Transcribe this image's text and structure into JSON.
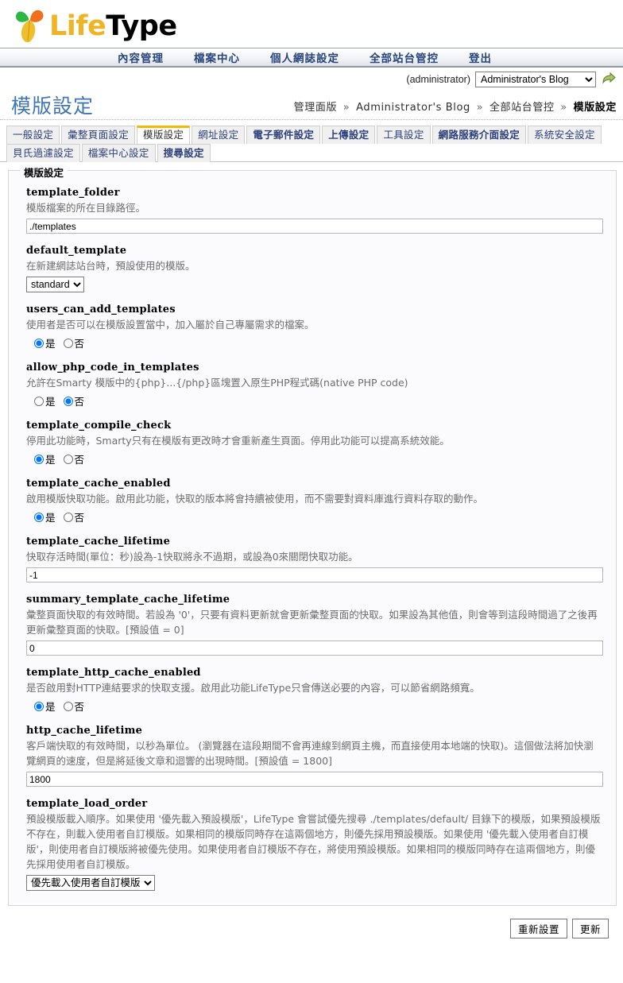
{
  "brand": {
    "life": "Life",
    "type": "Type",
    "logo_icon": "leaf-logo-icon"
  },
  "main_nav": {
    "items": [
      {
        "label": "內容管理"
      },
      {
        "label": "檔案中心"
      },
      {
        "label": "個人網誌設定"
      },
      {
        "label": "全部站台管控"
      },
      {
        "label": "登出"
      }
    ]
  },
  "blog_bar": {
    "admin_name": "(administrator)",
    "selected_blog": "Administrator's Blog",
    "blog_options": [
      "Administrator's Blog"
    ],
    "go_icon": "go-arrow-icon"
  },
  "page": {
    "title": "模版設定"
  },
  "breadcrumb": {
    "items": [
      "管理面版",
      "Administrator's Blog",
      "全部站台管控"
    ],
    "current": "模版設定",
    "separator": "»"
  },
  "tabs": [
    {
      "label": "一般設定",
      "active": false,
      "bold": false
    },
    {
      "label": "彙整頁面設定",
      "active": false,
      "bold": false
    },
    {
      "label": "模版設定",
      "active": true,
      "bold": false
    },
    {
      "label": "網址設定",
      "active": false,
      "bold": false
    },
    {
      "label": "電子郵件設定",
      "active": false,
      "bold": true
    },
    {
      "label": "上傳設定",
      "active": false,
      "bold": true
    },
    {
      "label": "工具設定",
      "active": false,
      "bold": false
    },
    {
      "label": "網路服務介面設定",
      "active": false,
      "bold": true
    },
    {
      "label": "系統安全設定",
      "active": false,
      "bold": false
    },
    {
      "label": "貝氏過濾設定",
      "active": false,
      "bold": false
    },
    {
      "label": "檔案中心設定",
      "active": false,
      "bold": false
    },
    {
      "label": "搜尋設定",
      "active": false,
      "bold": true
    }
  ],
  "panel": {
    "legend": "模版設定",
    "fields": [
      {
        "name": "template_folder",
        "desc": "模版檔案的所在目錄路徑。",
        "control": "text",
        "value": "./templates"
      },
      {
        "name": "default_template",
        "desc": "在新建網誌站台時，預設使用的模版。",
        "control": "select",
        "value": "standard",
        "options": [
          "standard"
        ]
      },
      {
        "name": "users_can_add_templates",
        "desc": "使用者是否可以在模版設置當中，加入屬於自己專屬需求的檔案。",
        "control": "radio",
        "options": [
          "是",
          "否"
        ],
        "value": "是"
      },
      {
        "name": "allow_php_code_in_templates",
        "desc": "允許在Smarty 模版中的{php}...{/php}區塊置入原生PHP程式碼(native PHP code)",
        "control": "radio",
        "options": [
          "是",
          "否"
        ],
        "value": "否"
      },
      {
        "name": "template_compile_check",
        "desc": "停用此功能時，Smarty只有在模版有更改時才會重新產生頁面。停用此功能可以提高系統效能。",
        "control": "radio",
        "options": [
          "是",
          "否"
        ],
        "value": "是"
      },
      {
        "name": "template_cache_enabled",
        "desc": "啟用模版快取功能。啟用此功能，快取的版本將會持續被使用，而不需要對資料庫進行資料存取的動作。",
        "control": "radio",
        "options": [
          "是",
          "否"
        ],
        "value": "是"
      },
      {
        "name": "template_cache_lifetime",
        "desc": "快取存活時間(單位：秒)設為-1快取將永不過期，或設為0來關閉快取功能。",
        "control": "text",
        "value": "-1"
      },
      {
        "name": "summary_template_cache_lifetime",
        "desc": "彙整頁面快取的有效時間。若設為 '0'，只要有資料更新就會更新彙整頁面的快取。如果設為其他值，則會等到這段時間過了之後再更新彙整頁面的快取。[預設值 = 0]",
        "control": "text",
        "value": "0"
      },
      {
        "name": "template_http_cache_enabled",
        "desc": "是否啟用對HTTP連結要求的快取支援。啟用此功能LifeType只會傳送必要的內容，可以節省網路頻寬。",
        "control": "radio",
        "options": [
          "是",
          "否"
        ],
        "value": "是"
      },
      {
        "name": "http_cache_lifetime",
        "desc": "客戶端快取的有效時間，以秒為單位。 (瀏覽器在這段期間不會再連線到網頁主機，而直接使用本地端的快取)。這個做法將加快瀏覽網頁的速度，但是將延後文章和迴響的出現時間。[預設值 = 1800]",
        "control": "text",
        "value": "1800"
      },
      {
        "name": "template_load_order",
        "desc": "預設模版載入順序。如果使用 '優先載入預設模版'，LifeType 會嘗試優先搜尋 ./templates/default/ 目錄下的模版，如果預設模版不存在，則載入使用者自訂模版。如果相同的模版同時存在這兩個地方，則優先採用預設模版。如果使用 '優先載入使用者自訂模版'，則使用者自訂模版將被優先使用。如果使用者自訂模版不存在，將使用預設模版。如果相同的模版同時存在這兩個地方，則優先採用使用者自訂模版。",
        "control": "select",
        "value": "優先載入使用者自訂模版",
        "options": [
          "優先載入使用者自訂模版",
          "優先載入預設模版"
        ]
      }
    ]
  },
  "actions": {
    "reset_label": "重新設置",
    "update_label": "更新"
  },
  "colors": {
    "title_blue": "#4176b4",
    "nav_blue": "#27447c",
    "tab_accent": "#f5b800",
    "logo_yellow": "#f0b323"
  }
}
